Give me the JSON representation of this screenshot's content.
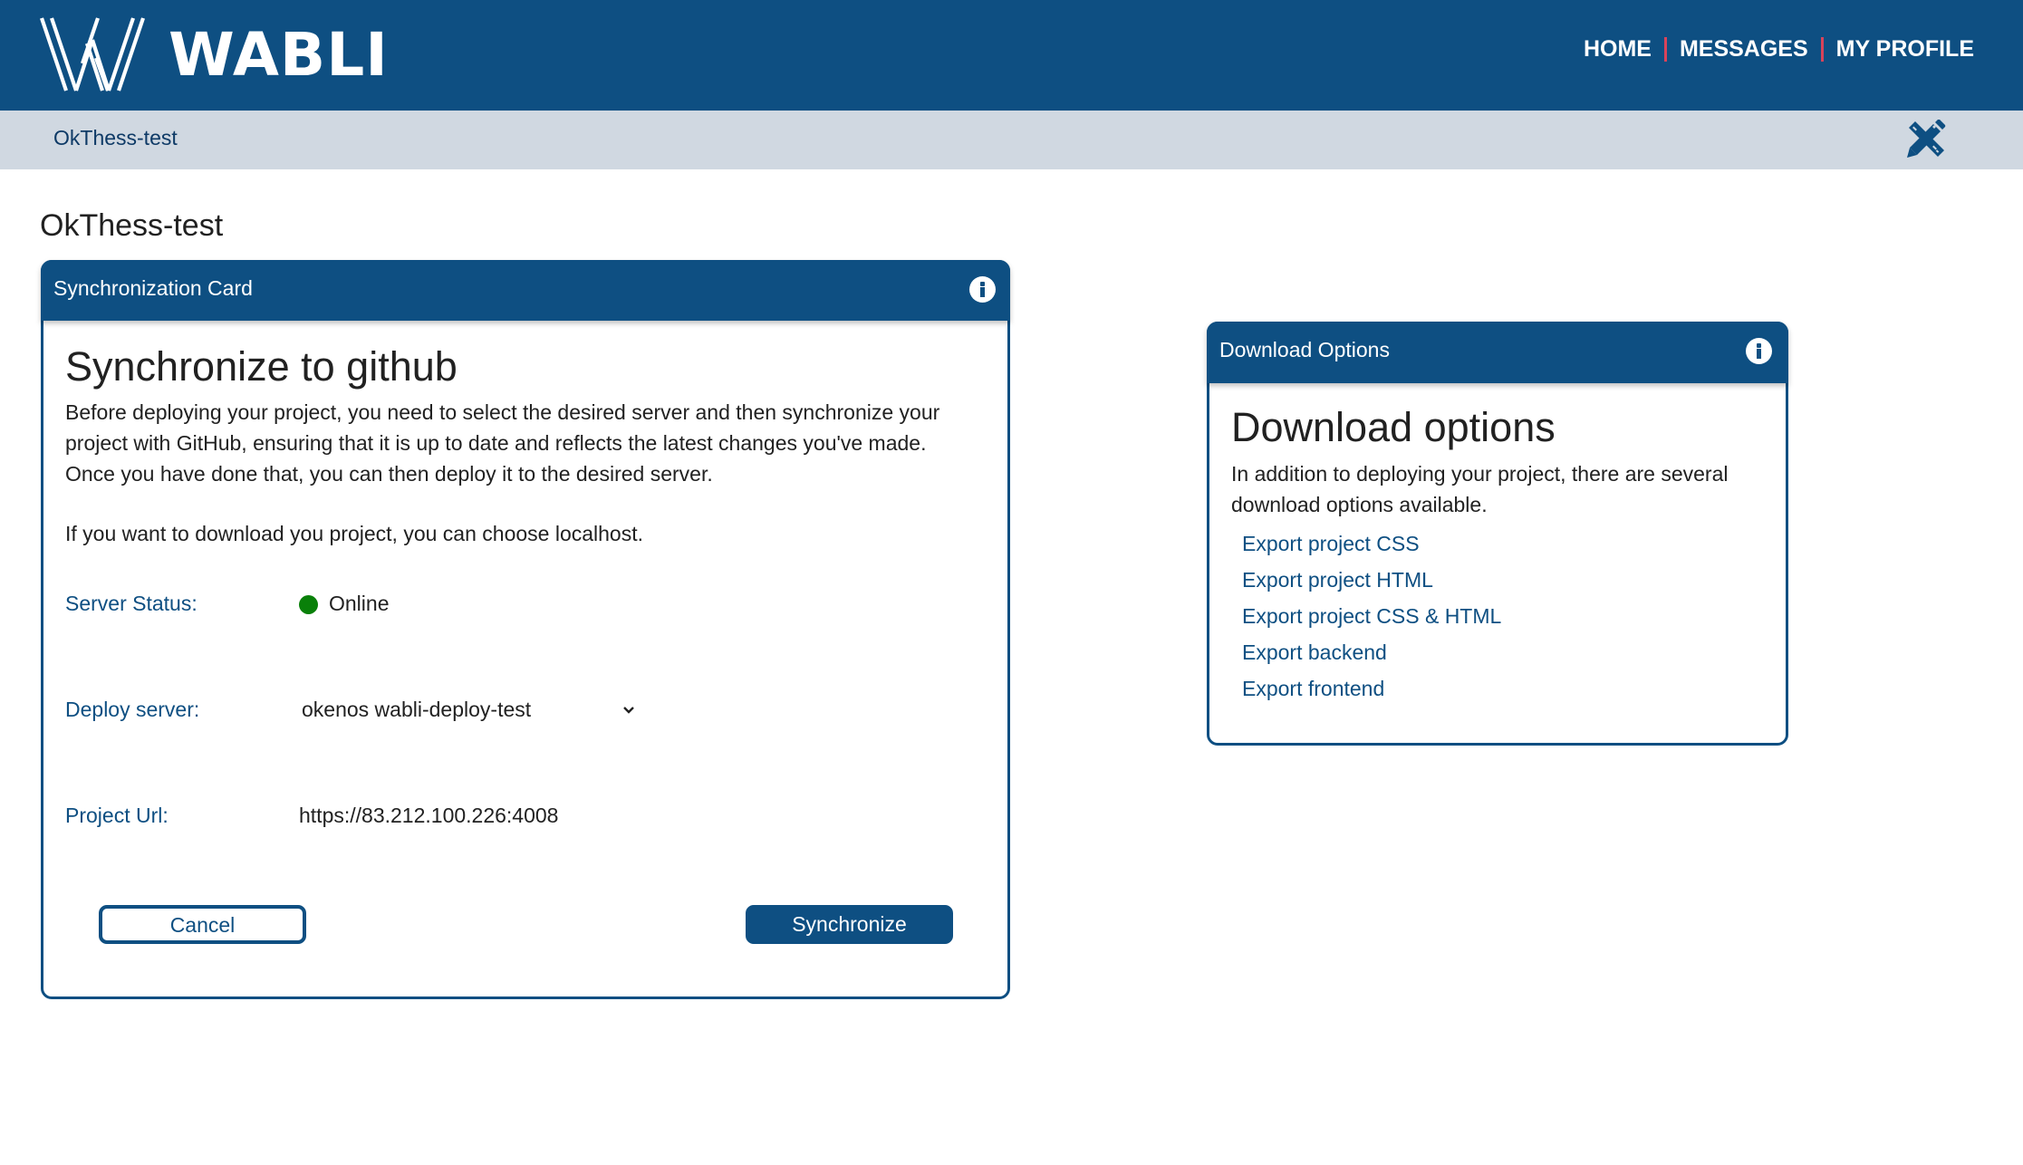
{
  "header": {
    "brand": "WABLI",
    "nav": [
      {
        "label": "HOME"
      },
      {
        "label": "MESSAGES"
      },
      {
        "label": "MY PROFILE"
      }
    ],
    "separator_color": "#d9435a"
  },
  "subheader": {
    "breadcrumb": "OkThess-test",
    "tools_icon": "pencil-ruler-icon"
  },
  "page": {
    "title": "OkThess-test"
  },
  "sync_card": {
    "header_title": "Synchronization Card",
    "info_icon": "info-icon",
    "heading": "Synchronize to github",
    "description": "Before deploying your project, you need to select the desired server and then synchronize your project with GitHub, ensuring that it is up to date and reflects the latest changes you've made. Once you have done that, you can then deploy it to the desired server.",
    "description_2": "If you want to download you project, you can choose localhost.",
    "server_status": {
      "label": "Server Status:",
      "value": "Online",
      "color": "#098009"
    },
    "deploy_server": {
      "label": "Deploy server:",
      "selected": "okenos wabli-deploy-test"
    },
    "project_url": {
      "label": "Project Url:",
      "value": "https://83.212.100.226:4008"
    },
    "cancel_label": "Cancel",
    "synchronize_label": "Synchronize"
  },
  "download_card": {
    "header_title": "Download Options",
    "info_icon": "info-icon",
    "heading": "Download options",
    "description": "In addition to deploying your project, there are several download options available.",
    "links": [
      {
        "label": "Export project CSS"
      },
      {
        "label": "Export project HTML"
      },
      {
        "label": "Export project CSS & HTML"
      },
      {
        "label": "Export backend"
      },
      {
        "label": "Export frontend"
      }
    ]
  },
  "colors": {
    "primary": "#0e4f82",
    "subheader_bg": "#d0d8e1"
  }
}
